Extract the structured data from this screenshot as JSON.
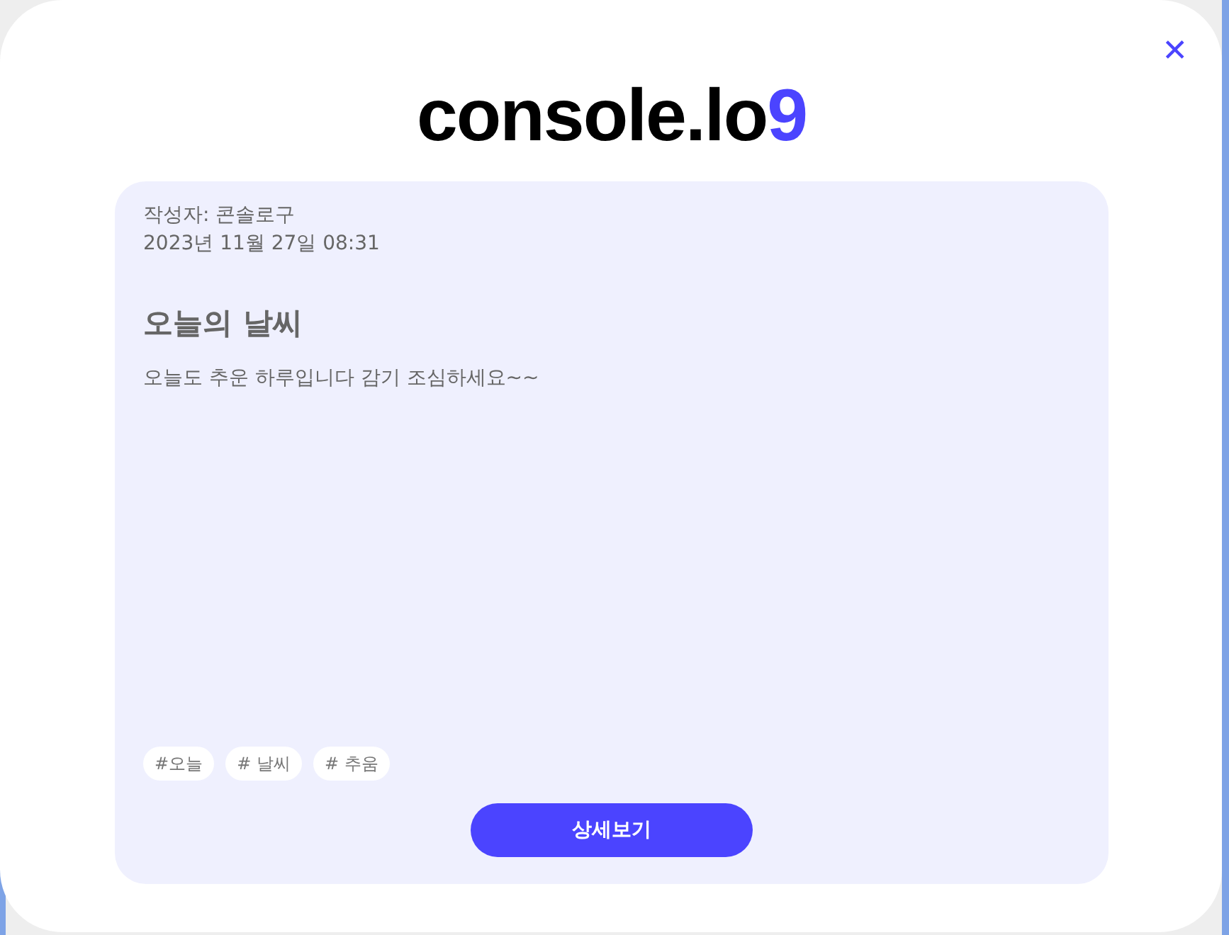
{
  "logo": {
    "text": "console.lo",
    "accent": "9"
  },
  "close": {
    "symbol": "✕"
  },
  "post": {
    "author": "작성자: 콘솔로구",
    "date": "2023년 11월 27일 08:31",
    "title": "오늘의 날씨",
    "body": "오늘도 추운 하루입니다 감기 조심하세요~~",
    "tags": [
      "#오늘",
      "# 날씨",
      "# 추움"
    ]
  },
  "buttons": [
    "상세보기"
  ]
}
